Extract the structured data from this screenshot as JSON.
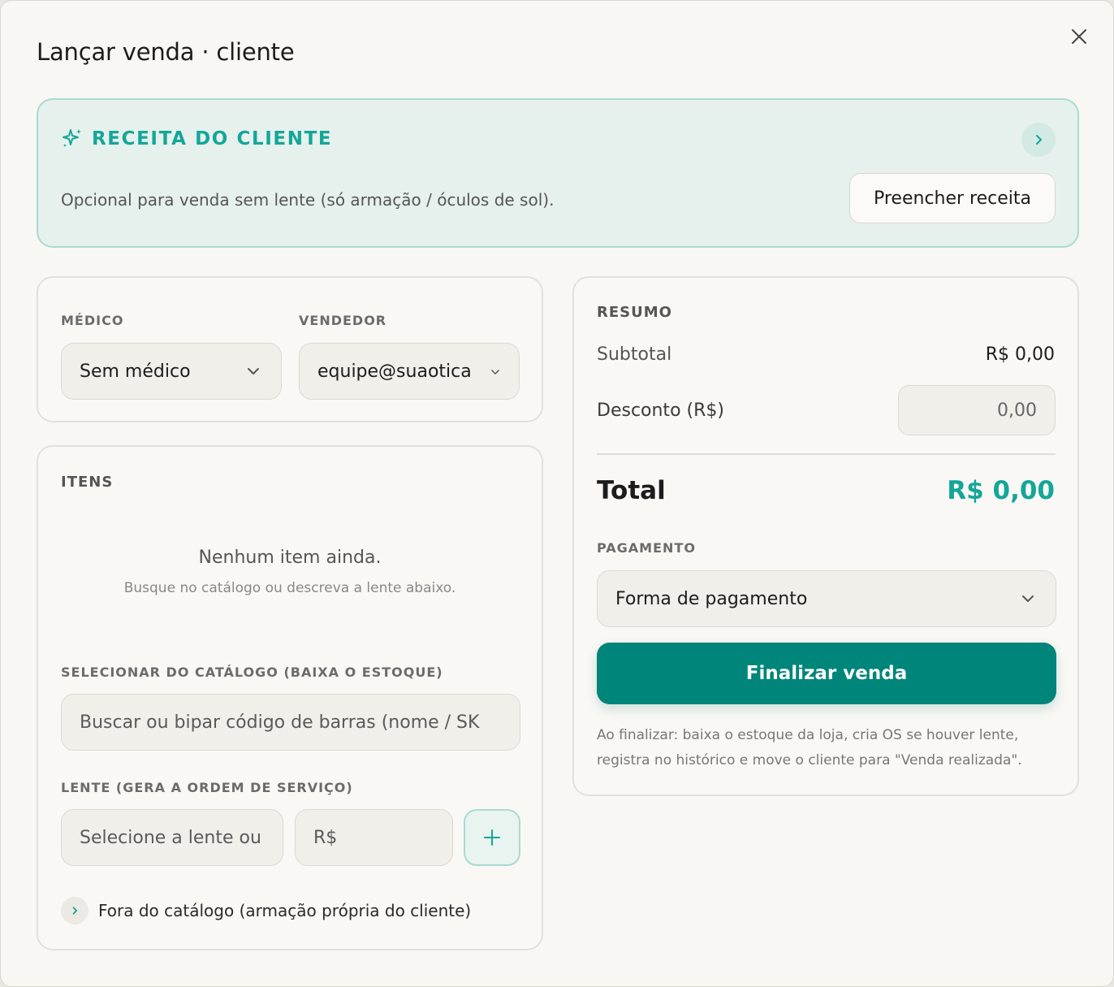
{
  "modal": {
    "title": "Lançar venda · cliente"
  },
  "receita": {
    "title": "RECEITA DO CLIENTE",
    "description": "Opcional para venda sem lente (só armação / óculos de sol).",
    "fill_button": "Preencher receita"
  },
  "people": {
    "medico_label": "MÉDICO",
    "medico_value": "Sem médico",
    "vendedor_label": "VENDEDOR",
    "vendedor_value": "equipe@suaotica"
  },
  "items": {
    "title": "ITENS",
    "empty_title": "Nenhum item ainda.",
    "empty_subtitle": "Busque no catálogo ou descreva a lente abaixo.",
    "catalog_label": "SELECIONAR DO CATÁLOGO (BAIXA O ESTOQUE)",
    "catalog_placeholder": "Buscar ou bipar código de barras (nome / SK",
    "lens_label": "LENTE (GERA A ORDEM DE SERVIÇO)",
    "lens_placeholder": "Selecione a lente ou",
    "price_placeholder": "R$",
    "fora_label": "Fora do catálogo (armação própria do cliente)"
  },
  "summary": {
    "title": "RESUMO",
    "subtotal_label": "Subtotal",
    "subtotal_value": "R$ 0,00",
    "discount_label": "Desconto (R$)",
    "discount_value": "0,00",
    "total_label": "Total",
    "total_value": "R$ 0,00",
    "payment_label": "PAGAMENTO",
    "payment_placeholder": "Forma de pagamento",
    "finalize_button": "Finalizar venda",
    "note": "Ao finalizar: baixa o estoque da loja, cria OS se houver lente, registra no histórico e move o cliente para \"Venda realizada\"."
  },
  "colors": {
    "accent": "#14a699",
    "primary_button": "#00857a"
  }
}
